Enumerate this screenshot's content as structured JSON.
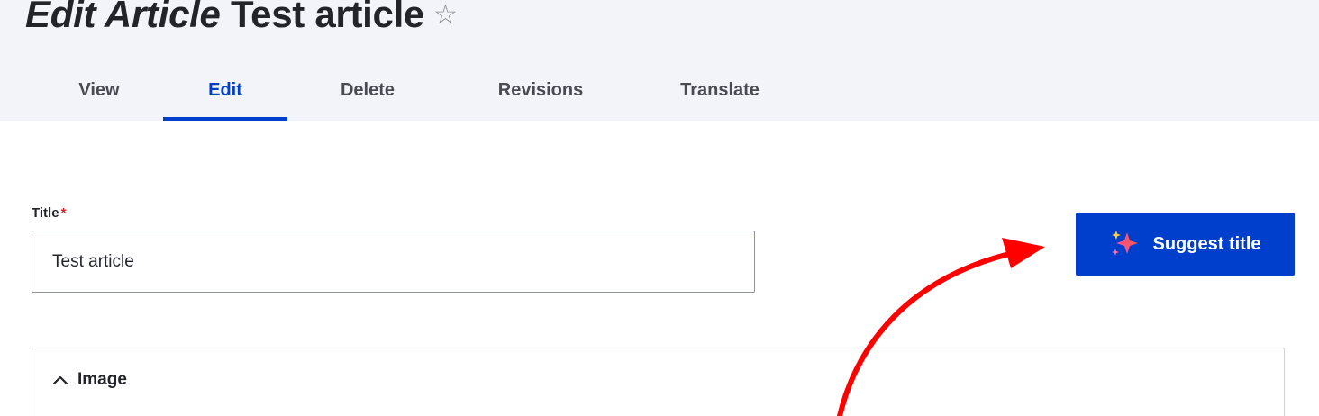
{
  "header": {
    "title_prefix": "Edit Article",
    "title_name": "Test article",
    "favorite_icon": "star-icon"
  },
  "tabs": [
    {
      "label": "View",
      "active": false
    },
    {
      "label": "Edit",
      "active": true
    },
    {
      "label": "Delete",
      "active": false
    },
    {
      "label": "Revisions",
      "active": false
    },
    {
      "label": "Translate",
      "active": false
    }
  ],
  "form": {
    "title_label": "Title",
    "required_marker": "*",
    "title_value": "Test article",
    "suggest_button_label": "Suggest title",
    "suggest_button_icon": "sparkle-icon",
    "image_section_label": "Image",
    "image_section_icon": "chevron-up-icon"
  },
  "colors": {
    "accent": "#003ecc",
    "header_bg": "#f3f4f9",
    "required": "#d72222",
    "annotation_arrow": "#ff0000"
  }
}
